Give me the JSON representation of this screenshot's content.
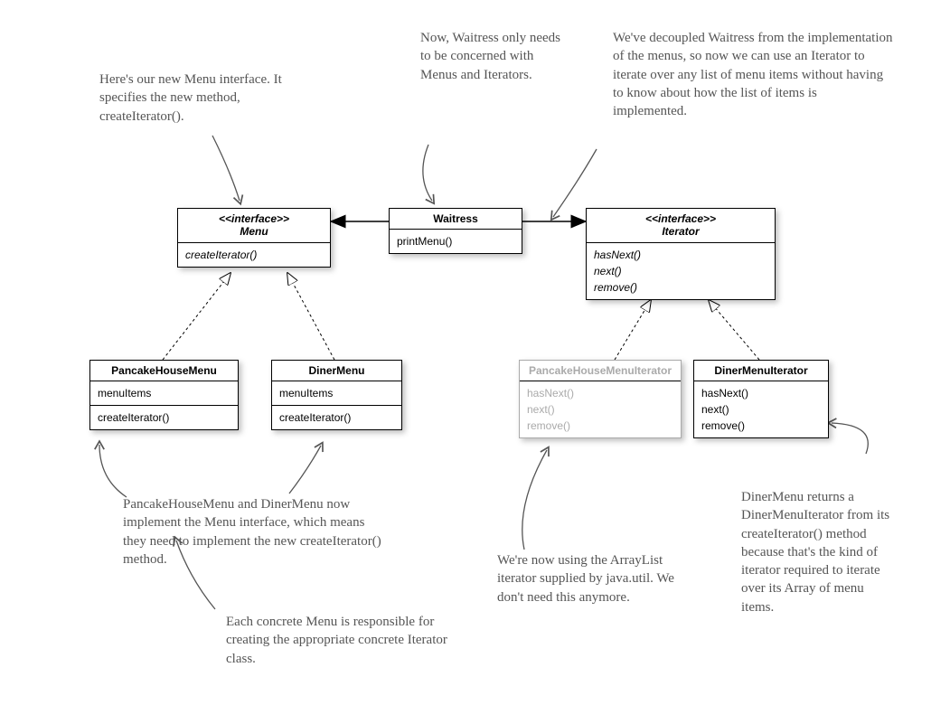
{
  "classes": {
    "menu": {
      "stereotype": "<<interface>>",
      "name": "Menu",
      "methods": [
        "createIterator()"
      ]
    },
    "waitress": {
      "name": "Waitress",
      "methods": [
        "printMenu()"
      ]
    },
    "iterator": {
      "stereotype": "<<interface>>",
      "name": "Iterator",
      "methods": [
        "hasNext()",
        "next()",
        "remove()"
      ]
    },
    "pancakeHouseMenu": {
      "name": "PancakeHouseMenu",
      "attrs": [
        "menuItems"
      ],
      "methods": [
        "createIterator()"
      ]
    },
    "dinerMenu": {
      "name": "DinerMenu",
      "attrs": [
        "menuItems"
      ],
      "methods": [
        "createIterator()"
      ]
    },
    "pancakeHouseMenuIterator": {
      "name": "PancakeHouseMenuIterator",
      "methods": [
        "hasNext()",
        "next()",
        "remove()"
      ]
    },
    "dinerMenuIterator": {
      "name": "DinerMenuIterator",
      "methods": [
        "hasNext()",
        "next()",
        "remove()"
      ]
    }
  },
  "annotations": {
    "a1": "Here's our new Menu interface. It specifies the new method, createIterator().",
    "a2": "Now, Waitress only needs to be concerned with Menus and Iterators.",
    "a3": "We've decoupled Waitress from the implementation of the menus, so now we can use an Iterator to iterate over any list of menu items without having to know about how the list of items is implemented.",
    "a4": "PancakeHouseMenu and DinerMenu now implement the Menu interface, which means they need to implement the new createIterator() method.",
    "a5": "Each concrete Menu is responsible for creating the appropriate concrete Iterator class.",
    "a6": "We're now using the ArrayList iterator supplied by java.util. We don't need this anymore.",
    "a7": "DinerMenu returns a DinerMenuIterator from its createIterator() method because that's the kind of iterator required to iterate over its Array of menu items."
  }
}
